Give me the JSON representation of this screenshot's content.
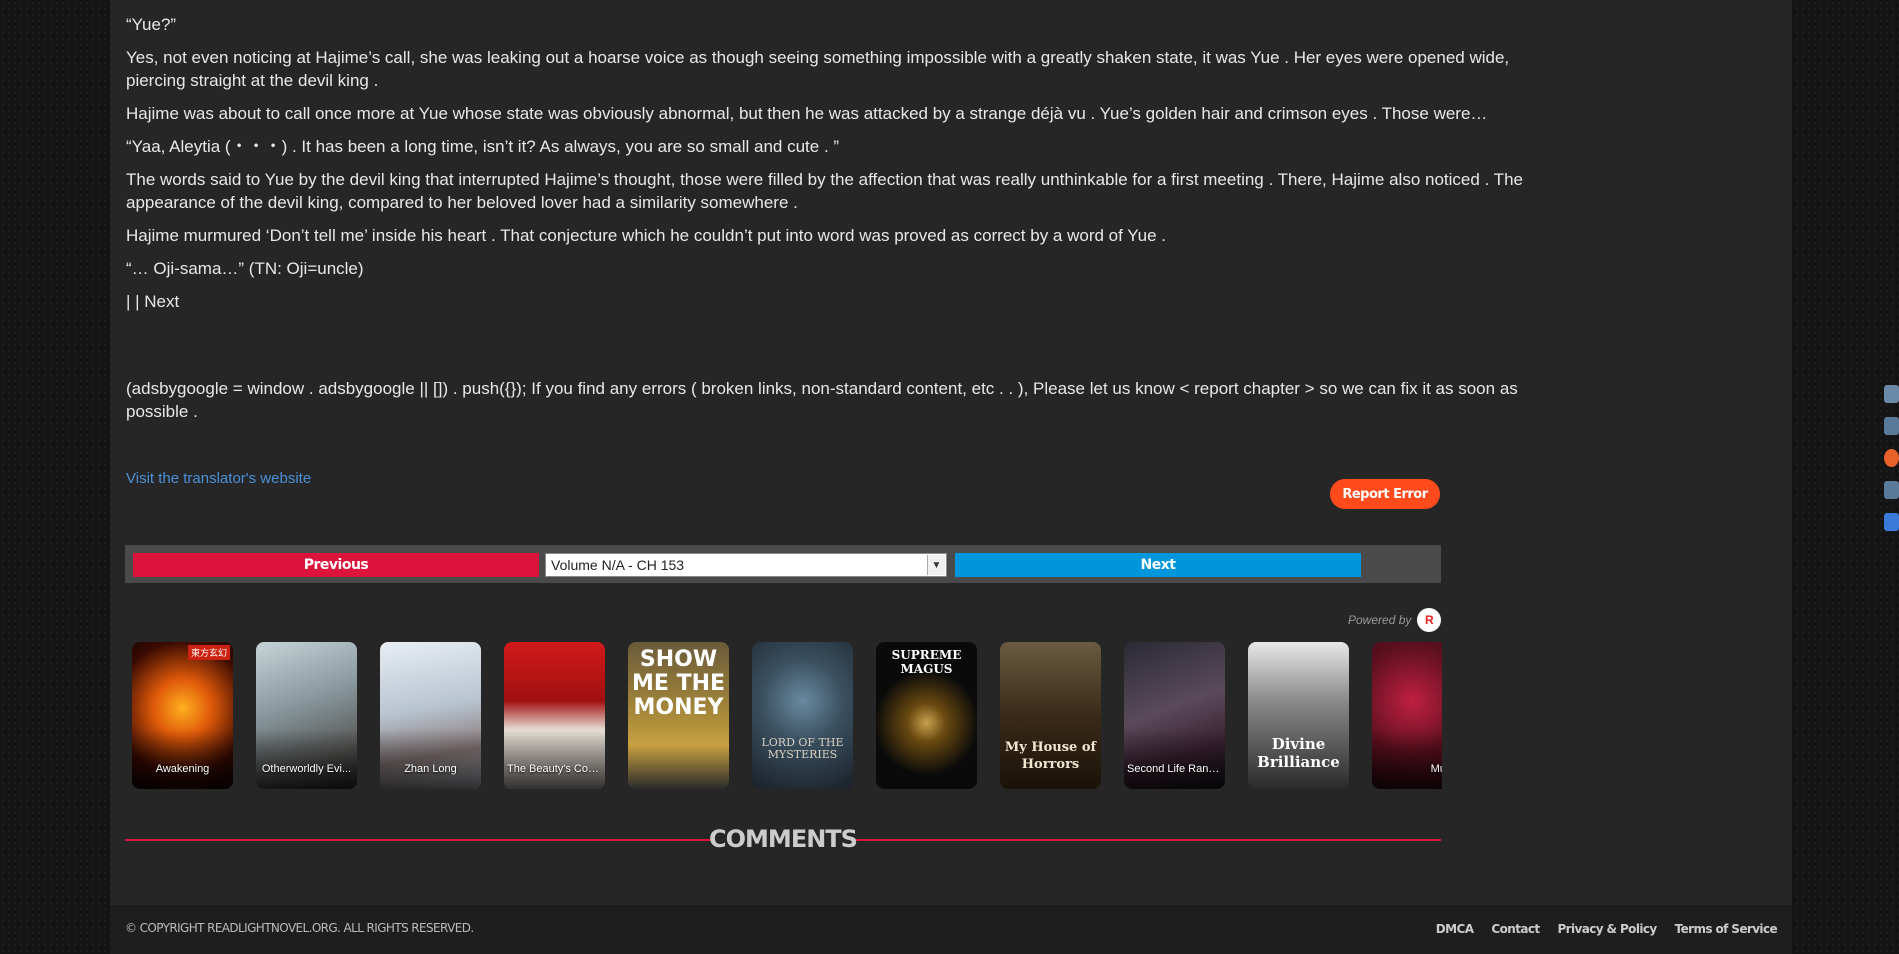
{
  "chapter": {
    "paragraphs": [
      "“Yue?”",
      "Yes, not even noticing at Hajime’s call, she was leaking out a hoarse voice as though seeing something impossible with a greatly shaken state, it was Yue . Her eyes were opened wide, piercing straight at the devil king .",
      "Hajime was about to call once more at Yue whose state was obviously abnormal, but then he was attacked by a strange déjà vu . Yue’s golden hair and crimson eyes . Those were…",
      "“Yaa, Aleytia (・・・) . It has been a long time, isn’t it? As always, you are so small and cute . ”",
      "The words said to Yue by the devil king that interrupted Hajime’s thought, those were filled by the affection that was really unthinkable for a first meeting . There, Hajime also noticed . The appearance of the devil king, compared to her beloved lover had a similarity somewhere .",
      "Hajime murmured ‘Don’t tell me’ inside his heart . That conjecture which he couldn’t put into word was proved as correct by a word of Yue .",
      "“… Oji-sama…” (TN: Oji=uncle)"
    ],
    "nav_line": " |  | Next",
    "ads_text": "(adsbygoogle = window . adsbygoogle || []) . push({}); If you find any errors ( broken links, non-standard content, etc . . ), Please let us know < report chapter > so we can fix it as soon as possible ."
  },
  "translator_link": "Visit the translator's website",
  "report_error": "Report Error",
  "nav": {
    "previous": "Previous",
    "next": "Next",
    "chapter_select": "Volume N/A - CH 153"
  },
  "powered_by": "Powered by",
  "recommendations": [
    {
      "title": "Awakening",
      "badge": "東方玄幻",
      "color": "#b33a0a"
    },
    {
      "title": "Otherworldly Evi...",
      "color": "#7a8a90"
    },
    {
      "title": "Zhan Long",
      "color": "#a9b6c4"
    },
    {
      "title": "The Beauty's Com...",
      "color": "#c81f1f"
    },
    {
      "title": "",
      "art": "SHOW ME THE MONEY",
      "color": "#8a6a2a"
    },
    {
      "title": "",
      "art": "LORD OF THE MYSTERIES",
      "color": "#3a4a5a"
    },
    {
      "title": "",
      "art": "SUPREME MAGUS",
      "color": "#111111"
    },
    {
      "title": "",
      "art": "My House of Horrors",
      "color": "#4a3a2a"
    },
    {
      "title": "Second Life Rank...",
      "color": "#3a3040"
    },
    {
      "title": "",
      "art": "Divine Brilliance",
      "color": "#555555"
    },
    {
      "title": "Mutager",
      "color": "#7a1020"
    }
  ],
  "comments_heading": "COMMENTS",
  "footer": {
    "copyright": "© COPYRIGHT  READLIGHTNOVEL.ORG. ALL RIGHTS RESERVED.",
    "links": [
      "DMCA",
      "Contact",
      "Privacy & Policy",
      "Terms of Service"
    ]
  },
  "colors": {
    "previous": "#dc143c",
    "next": "#0096dc",
    "report": "#ff4a1c",
    "link": "#4a90d9"
  }
}
